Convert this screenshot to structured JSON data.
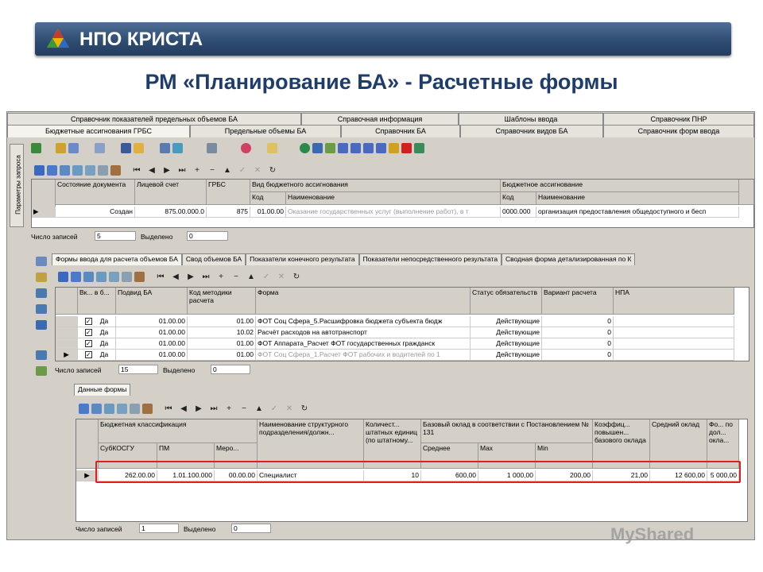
{
  "brand": "НПО КРИСТА",
  "slide_title": "РМ «Планирование БА» - Расчетные формы",
  "top_tabs_row1": [
    "Справочник показателей предельных объемов БА",
    "Справочная информация",
    "Шаблоны ввода",
    "Справочник ПНР"
  ],
  "top_tabs_row2": [
    "Бюджетные ассигнования ГРБС",
    "Предельные объемы БА",
    "Справочник БА",
    "Справочник видов БА",
    "Справочник форм ввода"
  ],
  "side_tab": "Параметры запроса",
  "grid1": {
    "headers": {
      "state": "Состояние документа",
      "account": "Лицевой счет",
      "grbs": "ГРБС",
      "vid": "Вид бюджетного ассигнования",
      "vid_code": "Код",
      "vid_name": "Наименование",
      "ba": "Бюджетное ассигнование",
      "ba_code": "Код",
      "ba_name": "Наименование"
    },
    "row": {
      "state": "Создан",
      "account": "875.00.000.0",
      "grbs": "875",
      "vid_code": "01.00.00",
      "vid_name": "Оказание государственных услуг (выполнение работ), в т",
      "ba_code": "0000.000",
      "ba_name": "организация предоставления общедоступного и бесп"
    },
    "status": {
      "count_label": "Число записей",
      "count": "5",
      "sel_label": "Выделено",
      "sel": "0"
    }
  },
  "subtabs": [
    "Формы ввода для расчета объемов БА",
    "Свод объемов БА",
    "Показатели конечного результата",
    "Показатели непосредственного результата",
    "Сводная форма детализированная по К"
  ],
  "grid2": {
    "headers": {
      "inc": "Вк... в б...",
      "podvid": "Подвид БА",
      "method": "Код методики расчета",
      "form": "Форма",
      "status": "Статус обязательств",
      "variant": "Вариант расчета",
      "npa": "НПА"
    },
    "rows": [
      {
        "inc": "Да",
        "podvid": "01.00.00",
        "method": "01.00",
        "form": "ФОТ Соц Сфера_5.Расшифровка бюджета субъекта бюдж",
        "status": "Действующие",
        "variant": "0"
      },
      {
        "inc": "Да",
        "podvid": "01.00.00",
        "method": "10.02",
        "form": "Расчёт расходов на автотранспорт",
        "status": "Действующие",
        "variant": "0"
      },
      {
        "inc": "Да",
        "podvid": "01.00.00",
        "method": "01.00",
        "form": "ФОТ Аппарата_Расчет ФОТ государственных гражданск",
        "status": "Действующие",
        "variant": "0"
      },
      {
        "inc": "Да",
        "podvid": "01.00.00",
        "method": "01.00",
        "form": "ФОТ Соц Сфера_1.Расчет ФОТ рабочих и водителей по 1",
        "status": "Действующие",
        "variant": "0"
      }
    ],
    "status": {
      "count_label": "Число записей",
      "count": "15",
      "sel_label": "Выделено",
      "sel": "0"
    }
  },
  "data_tab": "Данные формы",
  "grid3": {
    "headers": {
      "budget_class": "Бюджетная классификация",
      "subkosgu": "СубКОСГУ",
      "pm": "ПМ",
      "mero": "Меро...",
      "unit": "Наименование структурного подразделения/должн...",
      "qty": "Количест... штатных единиц (по штатному...",
      "base": "Базовый оклад в соответствии с Постановлением № 131",
      "avg": "Среднее",
      "max": "Max",
      "min": "Min",
      "coef": "Коэффиц... повышен... базового оклада",
      "mean_salary": "Средний оклад",
      "fo": "Фо... по дол... окла..."
    },
    "row": {
      "subkosgu": "262.00.00",
      "pm": "1.01.100.000",
      "mero": "00.00.00",
      "unit": "Специалист",
      "qty": "10",
      "avg": "600,00",
      "max": "1 000,00",
      "min": "200,00",
      "coef": "21,00",
      "mean_salary": "12 600,00",
      "fo": "5 000,00"
    },
    "status": {
      "count_label": "Число записей",
      "count": "1",
      "sel_label": "Выделено",
      "sel": "0"
    }
  },
  "watermark": "MyShared"
}
